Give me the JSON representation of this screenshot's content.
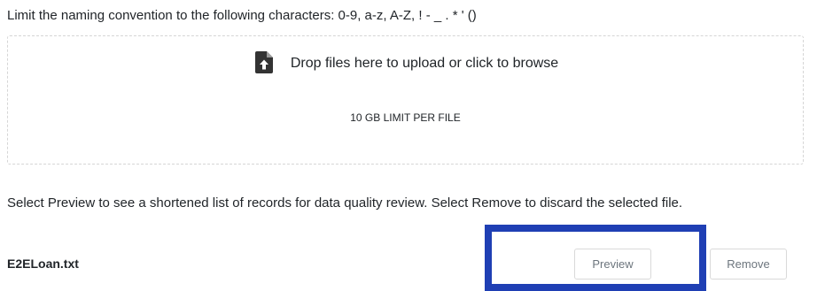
{
  "naming_note": "Limit the naming convention to the following characters: 0-9, a-z, A-Z, ! - _ . * ' ()",
  "dropzone": {
    "icon": "file-upload-icon",
    "text": "Drop files here to upload or click to browse",
    "limit": "10 GB LIMIT PER FILE"
  },
  "info_text": "Select Preview to see a shortened list of records for data quality review. Select Remove to discard the selected file.",
  "file": {
    "name": "E2ELoan.txt",
    "preview_label": "Preview",
    "remove_label": "Remove"
  },
  "colors": {
    "highlight": "#1f3fb4",
    "text": "#212529",
    "button_text": "#6c757d",
    "border": "#d6d6d6"
  }
}
